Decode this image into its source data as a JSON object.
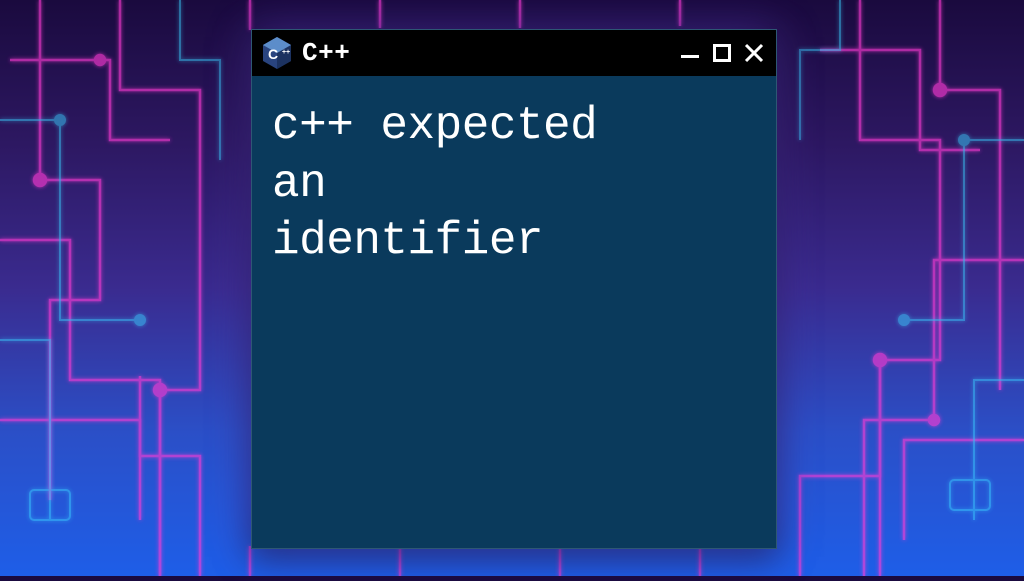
{
  "window": {
    "title": "C++",
    "icon_name": "cpp-hexagon-icon",
    "content_text": "c++ expected\nan\nidentifier"
  },
  "colors": {
    "titlebar_bg": "#000000",
    "content_bg": "#0a3a5c",
    "text": "#ffffff",
    "cpp_icon_primary": "#29447f",
    "cpp_icon_accent": "#5c8dca"
  }
}
